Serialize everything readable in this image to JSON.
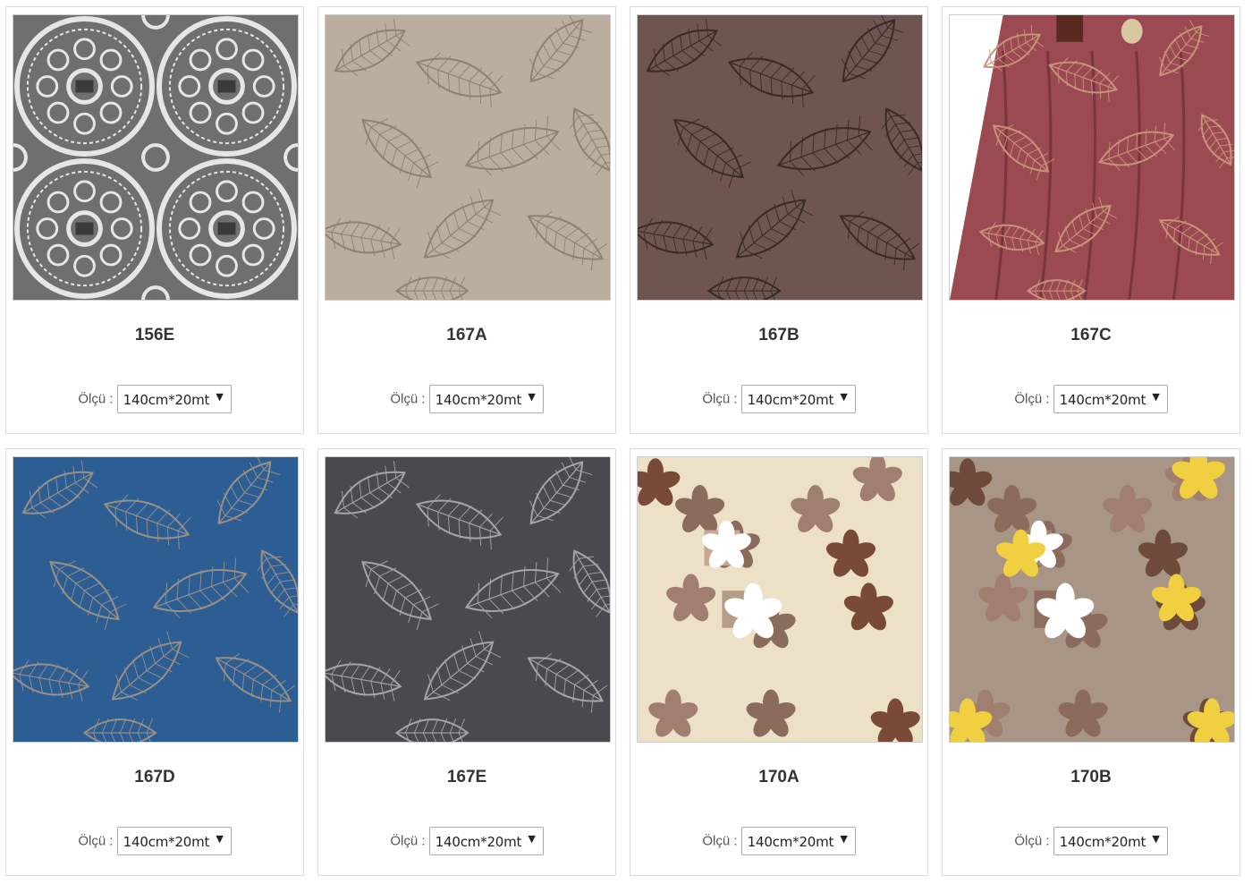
{
  "size_label": "Ölçü :",
  "products": [
    {
      "code": "156E",
      "size": "140cm*20mt",
      "icon": "lace-medallion-pattern-image",
      "colors": {
        "bg": "#6f6f6f",
        "fg": "#e6e6e6"
      }
    },
    {
      "code": "167A",
      "size": "140cm*20mt",
      "icon": "leaf-pattern-image",
      "colors": {
        "bg": "#bcae9f",
        "fg": "#8f8173"
      }
    },
    {
      "code": "167B",
      "size": "140cm*20mt",
      "icon": "leaf-pattern-image",
      "colors": {
        "bg": "#6e5550",
        "fg": "#3a2a27"
      }
    },
    {
      "code": "167C",
      "size": "140cm*20mt",
      "icon": "tablecloth-photo-image",
      "colors": {
        "bg": "#9a4a50",
        "fg": "#c9927a"
      }
    },
    {
      "code": "167D",
      "size": "140cm*20mt",
      "icon": "leaf-pattern-image",
      "colors": {
        "bg": "#2d5e93",
        "fg": "#9a8f86"
      }
    },
    {
      "code": "167E",
      "size": "140cm*20mt",
      "icon": "leaf-pattern-image",
      "colors": {
        "bg": "#4a4a4e",
        "fg": "#a5a5a8"
      }
    },
    {
      "code": "170A",
      "size": "140cm*20mt",
      "icon": "floral-pattern-image",
      "colors": {
        "bg": "#ece0c6",
        "fg": "#7a4a38"
      }
    },
    {
      "code": "170B",
      "size": "140cm*20mt",
      "icon": "floral-pattern-image",
      "colors": {
        "bg": "#a99585",
        "fg": "#6e4a3a"
      }
    }
  ]
}
